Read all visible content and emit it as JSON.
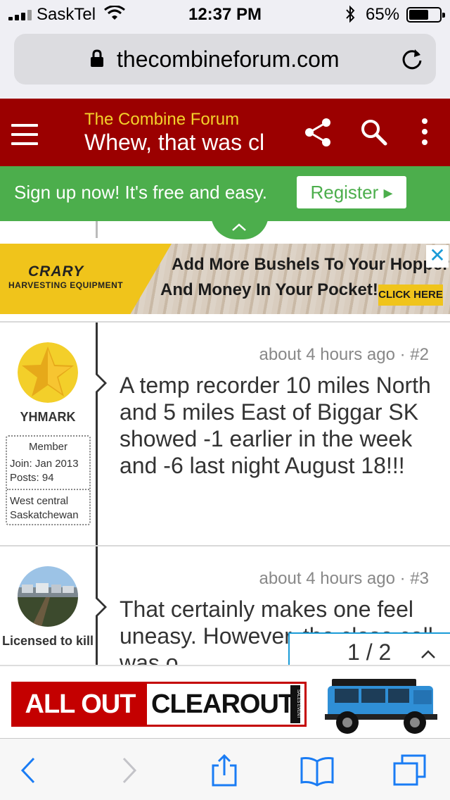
{
  "status_bar": {
    "carrier": "SaskTel",
    "time": "12:37 PM",
    "battery_percent": "65%",
    "battery_level": 0.65
  },
  "browser": {
    "url": "thecombineforum.com"
  },
  "forum_header": {
    "site_name": "The Combine Forum",
    "thread_title": "Whew, that was cl"
  },
  "signup_bar": {
    "message": "Sign up now! It's free and easy.",
    "register_label": "Register ▸"
  },
  "top_ad": {
    "brand": "CRARY",
    "brand_sub": "HARVESTING EQUIPMENT",
    "headline_1": "Add More Bushels To Your Hopper",
    "headline_2": "And Money In Your Pocket!",
    "cta": "CLICK HERE",
    "close": "✕"
  },
  "posts": [
    {
      "username": "YHMARK",
      "role": "Member",
      "join": "Join: Jan 2013",
      "posts": "Posts: 94",
      "location": "West central Saskatchewan",
      "meta": "about 4 hours ago · #2",
      "body": "A temp recorder 10 miles North and 5 miles East of Biggar SK showed -1 earlier in the week and -6 last night August 18!!!"
    },
    {
      "username": "Licensed to kill",
      "meta": "about 4 hours ago · #3",
      "body": "That certainly makes one feel uneasy. However, the close call was o"
    }
  ],
  "pager": {
    "label": "1 / 2"
  },
  "bottom_ad": {
    "part1": "ALL OUT",
    "part2": "CLEAROUT",
    "vertical_tag": "SALES EVENT"
  },
  "colors": {
    "forum_red": "#9b0000",
    "signup_green": "#4cae4c",
    "site_name_yellow": "#f3d22b",
    "ios_blue": "#1a9bd7"
  }
}
